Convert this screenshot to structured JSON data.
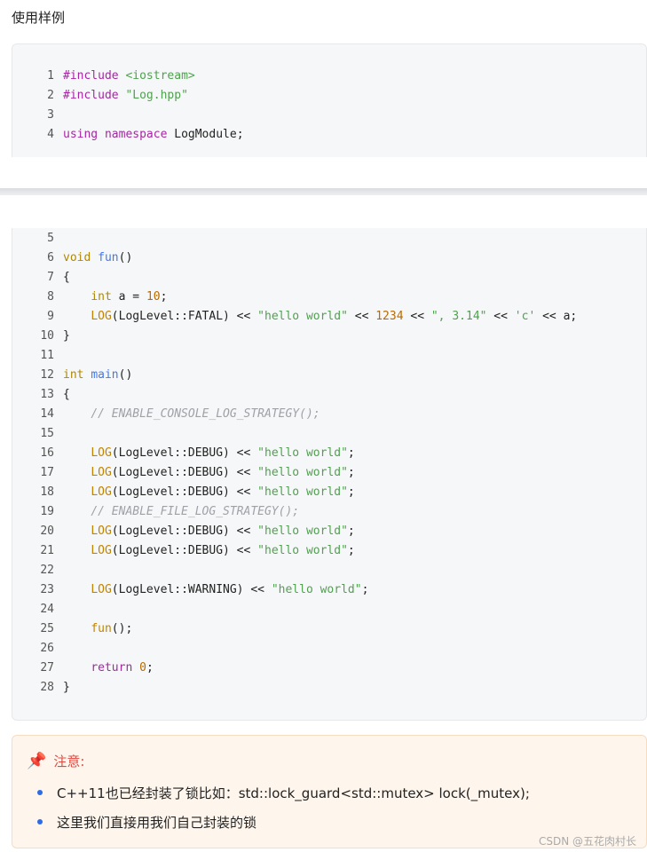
{
  "heading": "使用样例",
  "code_top": [
    {
      "num": "1",
      "parts": [
        [
          "pp",
          "#include "
        ],
        [
          "st",
          "<iostream>"
        ]
      ]
    },
    {
      "num": "2",
      "parts": [
        [
          "pp",
          "#include "
        ],
        [
          "st",
          "\"Log.hpp\""
        ]
      ]
    },
    {
      "num": "3",
      "parts": []
    },
    {
      "num": "4",
      "parts": [
        [
          "kw",
          "using "
        ],
        [
          "kw",
          "namespace "
        ],
        [
          "pl",
          "LogModule;"
        ]
      ]
    }
  ],
  "code_bottom": [
    {
      "num": "5",
      "parts": []
    },
    {
      "num": "6",
      "parts": [
        [
          "ty",
          "void "
        ],
        [
          "fn",
          "fun"
        ],
        [
          "pl",
          "()"
        ]
      ]
    },
    {
      "num": "7",
      "parts": [
        [
          "pl",
          "{"
        ]
      ]
    },
    {
      "num": "8",
      "parts": [
        [
          "pl",
          "    "
        ],
        [
          "ty",
          "int"
        ],
        [
          "pl",
          " a = "
        ],
        [
          "nu",
          "10"
        ],
        [
          "pl",
          ";"
        ]
      ]
    },
    {
      "num": "9",
      "parts": [
        [
          "pl",
          "    "
        ],
        [
          "mc",
          "LOG"
        ],
        [
          "pl",
          "(LogLevel::FATAL) << "
        ],
        [
          "st",
          "\"hello world\""
        ],
        [
          "pl",
          " << "
        ],
        [
          "nu",
          "1234"
        ],
        [
          "pl",
          " << "
        ],
        [
          "st",
          "\", 3.14\""
        ],
        [
          "pl",
          " << "
        ],
        [
          "st",
          "'c'"
        ],
        [
          "pl",
          " << a;"
        ]
      ]
    },
    {
      "num": "10",
      "parts": [
        [
          "pl",
          "}"
        ]
      ]
    },
    {
      "num": "11",
      "parts": []
    },
    {
      "num": "12",
      "parts": [
        [
          "ty",
          "int "
        ],
        [
          "fn",
          "main"
        ],
        [
          "pl",
          "()"
        ]
      ]
    },
    {
      "num": "13",
      "parts": [
        [
          "pl",
          "{"
        ]
      ]
    },
    {
      "num": "14",
      "parts": [
        [
          "pl",
          "    "
        ],
        [
          "cm",
          "// ENABLE_CONSOLE_LOG_STRATEGY();"
        ]
      ]
    },
    {
      "num": "15",
      "parts": []
    },
    {
      "num": "16",
      "parts": [
        [
          "pl",
          "    "
        ],
        [
          "mc",
          "LOG"
        ],
        [
          "pl",
          "(LogLevel::DEBUG) << "
        ],
        [
          "st",
          "\"hello world\""
        ],
        [
          "pl",
          ";"
        ]
      ]
    },
    {
      "num": "17",
      "parts": [
        [
          "pl",
          "    "
        ],
        [
          "mc",
          "LOG"
        ],
        [
          "pl",
          "(LogLevel::DEBUG) << "
        ],
        [
          "st",
          "\"hello world\""
        ],
        [
          "pl",
          ";"
        ]
      ]
    },
    {
      "num": "18",
      "parts": [
        [
          "pl",
          "    "
        ],
        [
          "mc",
          "LOG"
        ],
        [
          "pl",
          "(LogLevel::DEBUG) << "
        ],
        [
          "st",
          "\"hello world\""
        ],
        [
          "pl",
          ";"
        ]
      ]
    },
    {
      "num": "19",
      "parts": [
        [
          "pl",
          "    "
        ],
        [
          "cm",
          "// ENABLE_FILE_LOG_STRATEGY();"
        ]
      ]
    },
    {
      "num": "20",
      "parts": [
        [
          "pl",
          "    "
        ],
        [
          "mc",
          "LOG"
        ],
        [
          "pl",
          "(LogLevel::DEBUG) << "
        ],
        [
          "st",
          "\"hello world\""
        ],
        [
          "pl",
          ";"
        ]
      ]
    },
    {
      "num": "21",
      "parts": [
        [
          "pl",
          "    "
        ],
        [
          "mc",
          "LOG"
        ],
        [
          "pl",
          "(LogLevel::DEBUG) << "
        ],
        [
          "st",
          "\"hello world\""
        ],
        [
          "pl",
          ";"
        ]
      ]
    },
    {
      "num": "22",
      "parts": []
    },
    {
      "num": "23",
      "parts": [
        [
          "pl",
          "    "
        ],
        [
          "mc",
          "LOG"
        ],
        [
          "pl",
          "(LogLevel::WARNING) << "
        ],
        [
          "st",
          "\"hello world\""
        ],
        [
          "pl",
          ";"
        ]
      ]
    },
    {
      "num": "24",
      "parts": []
    },
    {
      "num": "25",
      "parts": [
        [
          "pl",
          "    "
        ],
        [
          "mc",
          "fun"
        ],
        [
          "pl",
          "();"
        ]
      ]
    },
    {
      "num": "26",
      "parts": []
    },
    {
      "num": "27",
      "parts": [
        [
          "pl",
          "    "
        ],
        [
          "kw",
          "return "
        ],
        [
          "nu",
          "0"
        ],
        [
          "pl",
          ";"
        ]
      ]
    },
    {
      "num": "28",
      "parts": [
        [
          "pl",
          "}"
        ]
      ]
    }
  ],
  "note": {
    "icon": "pushpin-icon",
    "title": "注意:",
    "items": [
      "C++11也已经封装了锁比如：std::lock_guard<std::mutex> lock(_mutex);",
      "这里我们直接用我们自己封装的锁"
    ]
  },
  "watermark": "CSDN @五花肉村长",
  "colors": {
    "keyword": "#a626a4",
    "type": "#b08800",
    "function": "#4078f2",
    "string": "#50a14f",
    "number": "#b76b01",
    "comment": "#a0a1a7",
    "note_title": "#e2473f",
    "note_bg": "#fef5ec"
  }
}
